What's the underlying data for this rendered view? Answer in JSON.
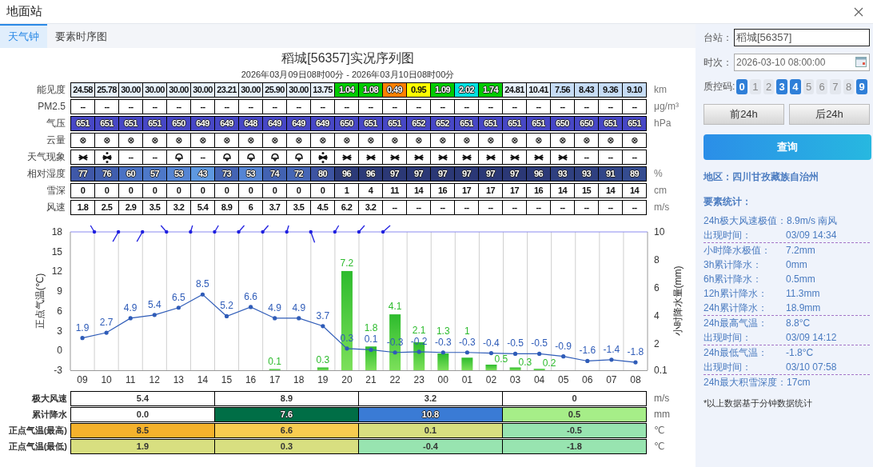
{
  "window": {
    "title": "地面站"
  },
  "tabs": [
    {
      "label": "天气钟",
      "selected": true
    },
    {
      "label": "要素时序图",
      "selected": false
    }
  ],
  "chart_title": "稻城[56357]实况序列图",
  "chart_subtitle": "2026年03月09日08时00分 - 2026年03月10日08时00分",
  "top_table": {
    "rows": [
      {
        "label": "能见度",
        "unit": "km",
        "cells": [
          {
            "text": "24.58",
            "color": "#e6f0fb"
          },
          {
            "text": "25.78",
            "color": "#e6f0fb"
          },
          {
            "text": "30.00",
            "color": "#e6f0fb"
          },
          {
            "text": "30.00",
            "color": "#e6f0fb"
          },
          {
            "text": "30.00",
            "color": "#e6f0fb"
          },
          {
            "text": "30.00",
            "color": "#e6f0fb"
          },
          {
            "text": "23.21",
            "color": "#e6f0fb"
          },
          {
            "text": "30.00",
            "color": "#e6f0fb"
          },
          {
            "text": "25.90",
            "color": "#e6f0fb"
          },
          {
            "text": "30.00",
            "color": "#e6f0fb"
          },
          {
            "text": "13.75",
            "color": "#e6f0fb"
          },
          {
            "text": "1.04",
            "color": "#00cc00"
          },
          {
            "text": "1.08",
            "color": "#00cc00"
          },
          {
            "text": "0.49",
            "color": "#ff8000"
          },
          {
            "text": "0.95",
            "color": "#ffff00"
          },
          {
            "text": "1.09",
            "color": "#00cc00"
          },
          {
            "text": "2.02",
            "color": "#00e0e0"
          },
          {
            "text": "1.74",
            "color": "#00cc00"
          },
          {
            "text": "24.81",
            "color": "#e6f0fb"
          },
          {
            "text": "10.41",
            "color": "#e6f0fb"
          },
          {
            "text": "7.56",
            "color": "#c6dcf5"
          },
          {
            "text": "8.43",
            "color": "#c6dcf5"
          },
          {
            "text": "9.36",
            "color": "#c6dcf5"
          },
          {
            "text": "9.10",
            "color": "#c6dcf5"
          }
        ]
      },
      {
        "label": "PM2.5",
        "unit": "μg/m³",
        "cells": [
          {
            "text": "--"
          },
          {
            "text": "--"
          },
          {
            "text": "--"
          },
          {
            "text": "--"
          },
          {
            "text": "--"
          },
          {
            "text": "--"
          },
          {
            "text": "--"
          },
          {
            "text": "--"
          },
          {
            "text": "--"
          },
          {
            "text": "--"
          },
          {
            "text": "--"
          },
          {
            "text": "--"
          },
          {
            "text": "--"
          },
          {
            "text": "--"
          },
          {
            "text": "--"
          },
          {
            "text": "--"
          },
          {
            "text": "--"
          },
          {
            "text": "--"
          },
          {
            "text": "--"
          },
          {
            "text": "--"
          },
          {
            "text": "--"
          },
          {
            "text": "--"
          },
          {
            "text": "--"
          },
          {
            "text": "--"
          }
        ]
      },
      {
        "label": "气压",
        "unit": "hPa",
        "cells": [
          {
            "text": "651",
            "color": "#4747c6"
          },
          {
            "text": "651",
            "color": "#4747c6"
          },
          {
            "text": "651",
            "color": "#4747c6"
          },
          {
            "text": "651",
            "color": "#4747c6"
          },
          {
            "text": "650",
            "color": "#4747c6"
          },
          {
            "text": "649",
            "color": "#4747c6"
          },
          {
            "text": "649",
            "color": "#4747c6"
          },
          {
            "text": "648",
            "color": "#4747c6"
          },
          {
            "text": "649",
            "color": "#4747c6"
          },
          {
            "text": "649",
            "color": "#4747c6"
          },
          {
            "text": "649",
            "color": "#4747c6"
          },
          {
            "text": "650",
            "color": "#4747c6"
          },
          {
            "text": "651",
            "color": "#4747c6"
          },
          {
            "text": "651",
            "color": "#4747c6"
          },
          {
            "text": "652",
            "color": "#4747c6"
          },
          {
            "text": "652",
            "color": "#4747c6"
          },
          {
            "text": "651",
            "color": "#4747c6"
          },
          {
            "text": "651",
            "color": "#4747c6"
          },
          {
            "text": "651",
            "color": "#4747c6"
          },
          {
            "text": "651",
            "color": "#4747c6"
          },
          {
            "text": "650",
            "color": "#4747c6"
          },
          {
            "text": "650",
            "color": "#4747c6"
          },
          {
            "text": "651",
            "color": "#4747c6"
          },
          {
            "text": "651",
            "color": "#4747c6"
          }
        ]
      },
      {
        "label": "云量",
        "cells": [
          {
            "text": "⊗"
          },
          {
            "text": "⊗"
          },
          {
            "text": "⊗"
          },
          {
            "text": "⊗"
          },
          {
            "text": "⊗"
          },
          {
            "text": "⊗"
          },
          {
            "text": "⊗"
          },
          {
            "text": "⊗"
          },
          {
            "text": "⊗"
          },
          {
            "text": "⊗"
          },
          {
            "text": "⊗"
          },
          {
            "text": "⊗"
          },
          {
            "text": "⊗"
          },
          {
            "text": "⊗"
          },
          {
            "text": "⊗"
          },
          {
            "text": "⊗"
          },
          {
            "text": "⊗"
          },
          {
            "text": "⊗"
          },
          {
            "text": "⊗"
          },
          {
            "text": "⊗"
          },
          {
            "text": "⊗"
          },
          {
            "text": "⊗"
          },
          {
            "text": "⊗"
          },
          {
            "text": "⊗"
          }
        ]
      },
      {
        "label": "天气现象",
        "cells": [
          {
            "kind": "snow"
          },
          {
            "kind": "snow-dotted"
          },
          {
            "kind": "text",
            "text": "--"
          },
          {
            "kind": "text",
            "text": "--"
          },
          {
            "kind": "cloud"
          },
          {
            "kind": "text",
            "text": "--"
          },
          {
            "kind": "cloud"
          },
          {
            "kind": "cloud"
          },
          {
            "kind": "cloud"
          },
          {
            "kind": "cloud"
          },
          {
            "kind": "snow-dotted"
          },
          {
            "kind": "snow"
          },
          {
            "kind": "snow"
          },
          {
            "kind": "snow"
          },
          {
            "kind": "snow"
          },
          {
            "kind": "snow"
          },
          {
            "kind": "snow"
          },
          {
            "kind": "snow"
          },
          {
            "kind": "snow"
          },
          {
            "kind": "snow"
          },
          {
            "kind": "snow"
          },
          {
            "kind": "text",
            "text": "--"
          },
          {
            "kind": "text",
            "text": "--"
          },
          {
            "kind": "text",
            "text": "--"
          }
        ]
      },
      {
        "label": "相对湿度",
        "unit": "%",
        "cells": [
          {
            "text": "77",
            "color": "#3f58a8"
          },
          {
            "text": "76",
            "color": "#405eae"
          },
          {
            "text": "60",
            "color": "#4a72c4"
          },
          {
            "text": "57",
            "color": "#4d78c8"
          },
          {
            "text": "53",
            "color": "#5585d4"
          },
          {
            "text": "43",
            "color": "#5e98e0"
          },
          {
            "text": "73",
            "color": "#4464b4"
          },
          {
            "text": "53",
            "color": "#5585d4"
          },
          {
            "text": "74",
            "color": "#4262b2"
          },
          {
            "text": "72",
            "color": "#4566b6"
          },
          {
            "text": "80",
            "color": "#3d54a2"
          },
          {
            "text": "96",
            "color": "#2c3a78"
          },
          {
            "text": "96",
            "color": "#2c3a78"
          },
          {
            "text": "97",
            "color": "#2b3876"
          },
          {
            "text": "97",
            "color": "#2b3876"
          },
          {
            "text": "97",
            "color": "#2b3876"
          },
          {
            "text": "97",
            "color": "#2b3876"
          },
          {
            "text": "97",
            "color": "#2b3876"
          },
          {
            "text": "97",
            "color": "#2b3876"
          },
          {
            "text": "96",
            "color": "#2c3a78"
          },
          {
            "text": "93",
            "color": "#2f4080"
          },
          {
            "text": "93",
            "color": "#2f4080"
          },
          {
            "text": "91",
            "color": "#324688"
          },
          {
            "text": "89",
            "color": "#354c90"
          }
        ]
      },
      {
        "label": "雪深",
        "unit": "cm",
        "cells": [
          {
            "text": "0"
          },
          {
            "text": "0"
          },
          {
            "text": "0"
          },
          {
            "text": "0"
          },
          {
            "text": "0"
          },
          {
            "text": "0"
          },
          {
            "text": "0"
          },
          {
            "text": "0"
          },
          {
            "text": "0"
          },
          {
            "text": "0"
          },
          {
            "text": "0"
          },
          {
            "text": "1"
          },
          {
            "text": "4"
          },
          {
            "text": "11"
          },
          {
            "text": "14"
          },
          {
            "text": "16"
          },
          {
            "text": "17"
          },
          {
            "text": "17"
          },
          {
            "text": "17"
          },
          {
            "text": "16"
          },
          {
            "text": "14"
          },
          {
            "text": "15"
          },
          {
            "text": "14"
          },
          {
            "text": "14"
          }
        ]
      },
      {
        "label": "风速",
        "unit": "m/s",
        "cells": [
          {
            "text": "1.8"
          },
          {
            "text": "2.5"
          },
          {
            "text": "2.9"
          },
          {
            "text": "3.5"
          },
          {
            "text": "3.2"
          },
          {
            "text": "5.4"
          },
          {
            "text": "8.9"
          },
          {
            "text": "6"
          },
          {
            "text": "3.7"
          },
          {
            "text": "3.5"
          },
          {
            "text": "4.5"
          },
          {
            "text": "6.2"
          },
          {
            "text": "3.2"
          },
          {
            "text": "--"
          },
          {
            "text": "--"
          },
          {
            "text": "--"
          },
          {
            "text": "--"
          },
          {
            "text": "--"
          },
          {
            "text": "--"
          },
          {
            "text": "--"
          },
          {
            "text": "--"
          },
          {
            "text": "--"
          },
          {
            "text": "--"
          },
          {
            "text": "--"
          }
        ]
      }
    ]
  },
  "chart_data": {
    "type": "bar",
    "ylabel": "正点气温(℃)",
    "y2label": "小时降水量(mm)",
    "categories": [
      "09",
      "10",
      "11",
      "12",
      "13",
      "14",
      "15",
      "16",
      "17",
      "18",
      "19",
      "20",
      "21",
      "22",
      "23",
      "00",
      "01",
      "02",
      "03",
      "04",
      "05",
      "06",
      "07",
      "08"
    ],
    "ylim": [
      -3,
      18
    ],
    "yticks": [
      -3,
      0,
      3,
      6,
      9,
      12,
      15,
      18
    ],
    "y2lim": [
      0.1,
      10
    ],
    "y2ticks": [
      0.1,
      2,
      4,
      6,
      8,
      10
    ],
    "data_labels": true,
    "series": [
      {
        "type": "bar",
        "axis": "y2",
        "color": "#2dbb2d",
        "values": [
          null,
          null,
          null,
          null,
          null,
          null,
          null,
          null,
          0.1,
          null,
          0.3,
          7.2,
          1.8,
          4.1,
          2.1,
          1.3,
          1,
          0.5,
          0.3,
          0.2,
          null,
          null,
          null,
          null
        ]
      },
      {
        "type": "line",
        "color": "#2f5cb8",
        "values": [
          1.9,
          2.7,
          4.9,
          5.4,
          6.5,
          8.5,
          5.2,
          6.6,
          4.9,
          4.9,
          3.7,
          0.3,
          0.1,
          -0.3,
          -0.2,
          -0.3,
          -0.3,
          -0.4,
          -0.5,
          -0.5,
          -0.9,
          -1.6,
          -1.4,
          -1.8
        ]
      }
    ]
  },
  "bottom_table": {
    "rows": [
      {
        "label": "极大风速",
        "unit": "m/s",
        "cells": [
          {
            "text": "5.4",
            "color": "#ffffff"
          },
          {
            "text": "8.9",
            "color": "#ffffff"
          },
          {
            "text": "3.2",
            "color": "#ffffff"
          },
          {
            "text": "0",
            "color": "#ffffff"
          }
        ]
      },
      {
        "label": "累计降水",
        "unit": "mm",
        "cells": [
          {
            "text": "0.0",
            "color": "#ffffff"
          },
          {
            "text": "7.6",
            "color": "#006e46"
          },
          {
            "text": "10.8",
            "color": "#3a7bd5"
          },
          {
            "text": "0.5",
            "color": "#a6ee88"
          }
        ]
      },
      {
        "label": "正点气温(最高)",
        "unit": "℃",
        "cells": [
          {
            "text": "8.5",
            "color": "#f5b22c"
          },
          {
            "text": "6.6",
            "color": "#f8cc50"
          },
          {
            "text": "0.1",
            "color": "#d8df80"
          },
          {
            "text": "-0.5",
            "color": "#98e4b0"
          }
        ]
      },
      {
        "label": "正点气温(最低)",
        "unit": "℃",
        "cells": [
          {
            "text": "1.9",
            "color": "#d8df80"
          },
          {
            "text": "0.3",
            "color": "#d8df80"
          },
          {
            "text": "-0.4",
            "color": "#98e4b0"
          },
          {
            "text": "-1.8",
            "color": "#98e4b0"
          }
        ]
      }
    ]
  },
  "side": {
    "station": {
      "label": "台站：",
      "value": "稻城[56357]"
    },
    "time": {
      "label": "时次：",
      "value": "2026-03-10 08:00:00"
    },
    "qc": {
      "label": "质控码:",
      "codes": [
        {
          "text": "0",
          "selected": true
        },
        {
          "text": "1",
          "selected": false
        },
        {
          "text": "2",
          "selected": false
        },
        {
          "text": "3",
          "selected": true
        },
        {
          "text": "4",
          "selected": true
        },
        {
          "text": "5",
          "selected": false
        },
        {
          "text": "6",
          "selected": false
        },
        {
          "text": "7",
          "selected": false
        },
        {
          "text": "8",
          "selected": false
        },
        {
          "text": "9",
          "selected": true
        }
      ]
    },
    "buttons": [
      "前24h",
      "后24h"
    ],
    "query": "查询",
    "region": "地区：四川甘孜藏族自治州",
    "stats_title": "要素统计：",
    "stats": [
      [
        {
          "label": "24h极大风速极值：",
          "value": "8.9m/s 南风"
        },
        {
          "label": "出现时间：",
          "value": "03/09 14:34"
        }
      ],
      [
        {
          "label": "小时降水极值：",
          "value": "7.2mm"
        },
        {
          "label": "3h累计降水：",
          "value": "0mm"
        },
        {
          "label": "6h累计降水：",
          "value": "0.5mm"
        },
        {
          "label": "12h累计降水：",
          "value": "11.3mm"
        },
        {
          "label": "24h累计降水：",
          "value": "18.9mm"
        }
      ],
      [
        {
          "label": "24h最高气温：",
          "value": "8.8°C"
        },
        {
          "label": "出现时间：",
          "value": "03/09 14:12"
        }
      ],
      [
        {
          "label": "24h最低气温：",
          "value": "-1.8°C"
        },
        {
          "label": "出现时间：",
          "value": "03/10 07:58"
        }
      ],
      [
        {
          "label": "24h最大积雪深度：",
          "value": "17cm"
        }
      ]
    ],
    "note": "*以上数据基于分钟数据统计"
  }
}
